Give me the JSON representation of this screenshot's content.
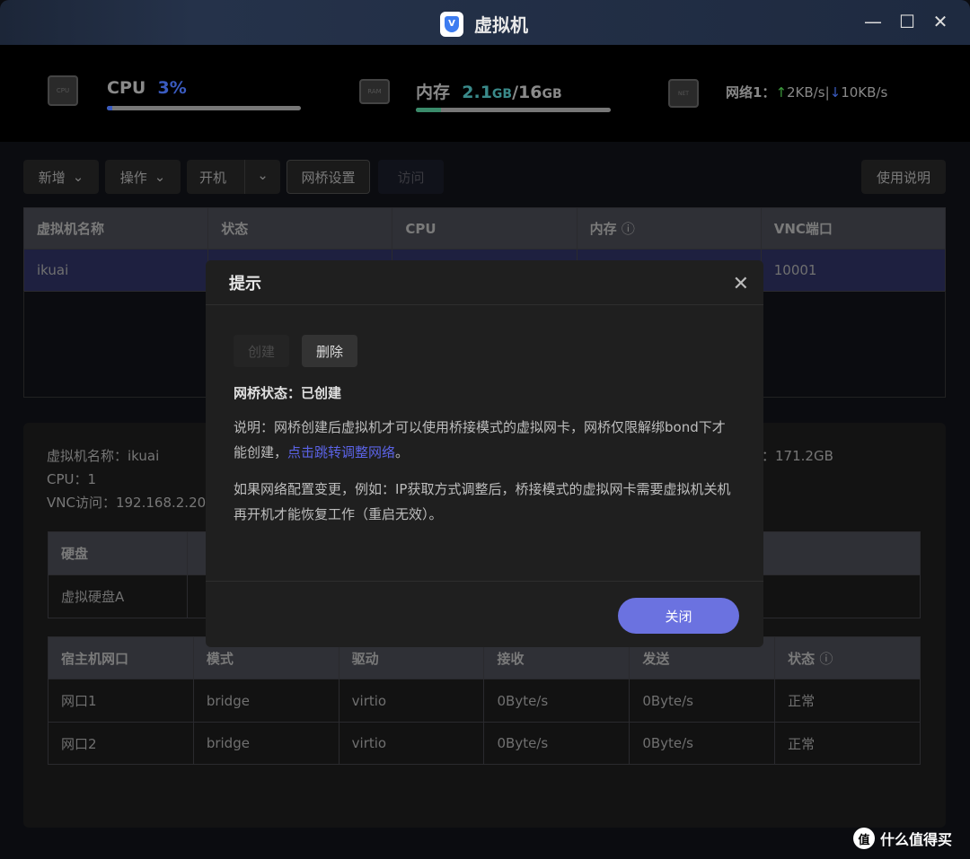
{
  "window": {
    "title": "虚拟机",
    "logo_letter": "V",
    "controls": {
      "minimize": "—",
      "maximize": "☐",
      "close": "✕"
    }
  },
  "stats": {
    "cpu": {
      "label": "CPU",
      "value": "3%",
      "progress_percent": 3,
      "color": "#3a5bc0",
      "chip_text": "CPU"
    },
    "memory": {
      "label": "内存",
      "used": "2.1",
      "used_unit": "GB",
      "separator": "/",
      "total": "16",
      "total_unit": "GB",
      "progress_percent": 13,
      "color": "#3a8a6a",
      "chip_text": "RAM"
    },
    "network": {
      "label": "网络1：",
      "up_arrow": "↑",
      "up": "2KB/s",
      "divider": "|",
      "down_arrow": "↓",
      "down": "10KB/s",
      "chip_text": "NET",
      "up_color": "#3c9a3c",
      "down_color": "#3a5bc0"
    }
  },
  "toolbar": {
    "add": "新增",
    "operate": "操作",
    "power_on": "开机",
    "bridge_settings": "网桥设置",
    "visit": "访问",
    "help": "使用说明"
  },
  "vm_table": {
    "headers": [
      "虚拟机名称",
      "状态",
      "CPU",
      "内存",
      "VNC端口"
    ],
    "rows": [
      [
        "ikuai",
        "",
        "",
        "",
        "10001"
      ]
    ]
  },
  "details": {
    "name": "虚拟机名称：ikuai",
    "cpu": "CPU：1",
    "vnc": "VNC访问：192.168.2.20",
    "disk_size": "：171.2GB"
  },
  "disk_table": {
    "headers": [
      "硬盘"
    ],
    "rows": [
      [
        "虚拟硬盘A"
      ]
    ]
  },
  "nic_table": {
    "headers": [
      "宿主机网口",
      "模式",
      "驱动",
      "接收",
      "发送",
      "状态"
    ],
    "rows": [
      [
        "网口1",
        "bridge",
        "virtio",
        "0Byte/s",
        "0Byte/s",
        "正常"
      ],
      [
        "网口2",
        "bridge",
        "virtio",
        "0Byte/s",
        "0Byte/s",
        "正常"
      ]
    ]
  },
  "modal": {
    "title": "提示",
    "create": "创建",
    "delete": "删除",
    "status": "网桥状态：已创建",
    "desc_prefix": "说明：网桥创建后虚拟机才可以使用桥接模式的虚拟网卡，网桥仅限解绑bond下才能创建，",
    "desc_link": "点击跳转调整网络",
    "desc_suffix": "。",
    "note": "如果网络配置变更，例如：IP获取方式调整后，桥接模式的虚拟网卡需要虚拟机关机再开机才能恢复工作（重启无效）。",
    "close_button": "关闭",
    "link_color": "#5b63e6"
  },
  "watermark": {
    "icon": "值",
    "text": "什么值得买"
  }
}
